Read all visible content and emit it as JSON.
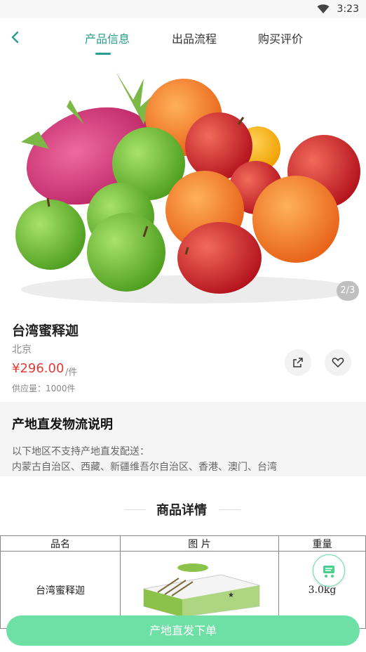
{
  "status_bar": {
    "time": "3:23"
  },
  "nav": {
    "tabs": [
      {
        "label": "产品信息",
        "active": true
      },
      {
        "label": "出品流程",
        "active": false
      },
      {
        "label": "购买评价",
        "active": false
      }
    ],
    "accent_color": "#2a9d8f"
  },
  "gallery": {
    "pager": "2/3"
  },
  "product": {
    "name": "台湾蜜释迦",
    "origin": "北京",
    "price": "¥296.00",
    "unit": "/件",
    "supply": "供应量：1000件"
  },
  "logistics": {
    "title": "产地直发物流说明",
    "line1": "以下地区不支持产地直发配送：",
    "line2": "内蒙古自治区、西藏、新疆维吾尔自治区、香港、澳门、台湾"
  },
  "details": {
    "title": "商品详情",
    "table": {
      "headers": [
        "品名",
        "图 片",
        "重量"
      ],
      "rows": [
        {
          "name": "台湾蜜释迦",
          "weight": "3.0kg"
        }
      ]
    }
  },
  "actions": {
    "order_label": "产地直发下单",
    "order_color": "#6ee0a6"
  },
  "icons": [
    "wifi-icon",
    "back-icon",
    "share-icon",
    "heart-icon",
    "cart-icon"
  ]
}
